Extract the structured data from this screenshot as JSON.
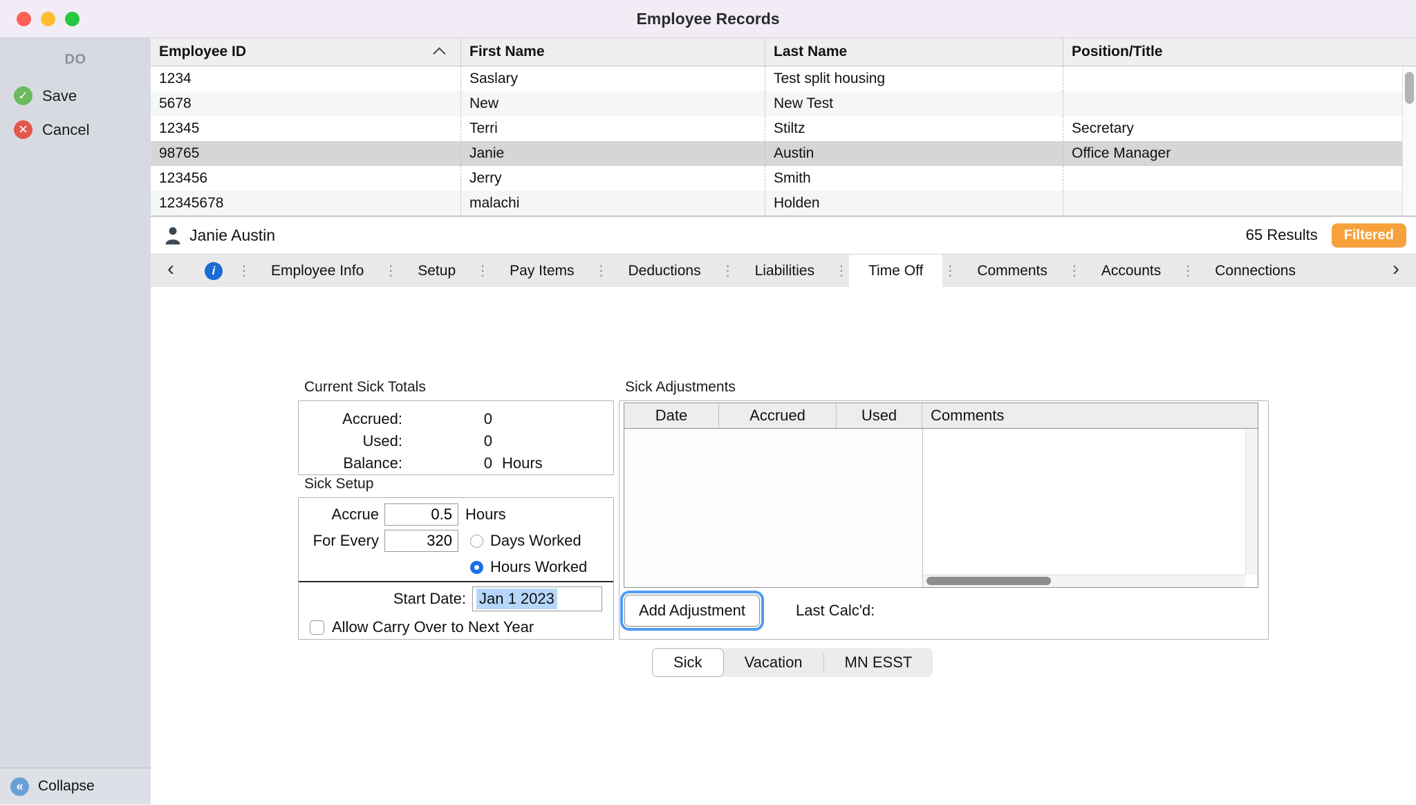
{
  "window": {
    "title": "Employee Records"
  },
  "sidebar": {
    "header": "DO",
    "save_label": "Save",
    "cancel_label": "Cancel",
    "collapse_label": "Collapse"
  },
  "icons": {
    "check": "✓",
    "cross": "✕",
    "collapse": "«",
    "chevron_left": "‹",
    "chevron_right": "›",
    "separator": "⋮",
    "info": "i"
  },
  "table": {
    "columns": [
      "Employee ID",
      "First Name",
      "Last Name",
      "Position/Title"
    ],
    "rows": [
      [
        "1234",
        "Saslary",
        "Test split housing",
        ""
      ],
      [
        "5678",
        "New",
        "New Test",
        ""
      ],
      [
        "12345",
        "Terri",
        "Stiltz",
        "Secretary"
      ],
      [
        "98765",
        "Janie",
        "Austin",
        "Office Manager"
      ],
      [
        "123456",
        "Jerry",
        "Smith",
        ""
      ],
      [
        "12345678",
        "malachi",
        "Holden",
        ""
      ]
    ],
    "selected_row": "98765"
  },
  "status": {
    "record_name": "Janie Austin",
    "results": "65 Results",
    "filter_badge": "Filtered"
  },
  "tabs": {
    "items": [
      "Employee Info",
      "Setup",
      "Pay Items",
      "Deductions",
      "Liabilities",
      "Time Off",
      "Comments",
      "Accounts",
      "Connections"
    ],
    "selected": "Time Off"
  },
  "time_off": {
    "totals": {
      "title": "Current Sick Totals",
      "rows": [
        {
          "label": "Accrued:",
          "value": "0",
          "unit": ""
        },
        {
          "label": "Used:",
          "value": "0",
          "unit": ""
        },
        {
          "label": "Balance:",
          "value": "0",
          "unit": "Hours"
        }
      ]
    },
    "setup": {
      "title": "Sick Setup",
      "accrue_label": "Accrue",
      "accrue_value": "0.5",
      "accrue_unit": "Hours",
      "for_every_label": "For Every",
      "for_every_value": "320",
      "radio_days_label": "Days Worked",
      "radio_hours_label": "Hours Worked",
      "radio_selected": "Hours Worked",
      "start_date_label": "Start Date:",
      "start_date_value": "Jan 1 2023",
      "carry_over_label": "Allow Carry Over to Next Year",
      "carry_over_checked": false
    },
    "adjustments": {
      "title": "Sick Adjustments",
      "columns": [
        "Date",
        "Accrued",
        "Used",
        "Comments"
      ],
      "add_button_label": "Add Adjustment",
      "last_calcd_label": "Last Calc'd:"
    },
    "subtabs": {
      "items": [
        "Sick",
        "Vacation",
        "MN ESST"
      ],
      "selected": "Sick"
    }
  },
  "colors": {
    "accent_blue": "#1d6fe8",
    "badge_orange": "#f6a13b",
    "selection_highlight": "#b6d7fb",
    "titlebar": "#f1ecf6",
    "sidebar": "#d7dbe1"
  }
}
